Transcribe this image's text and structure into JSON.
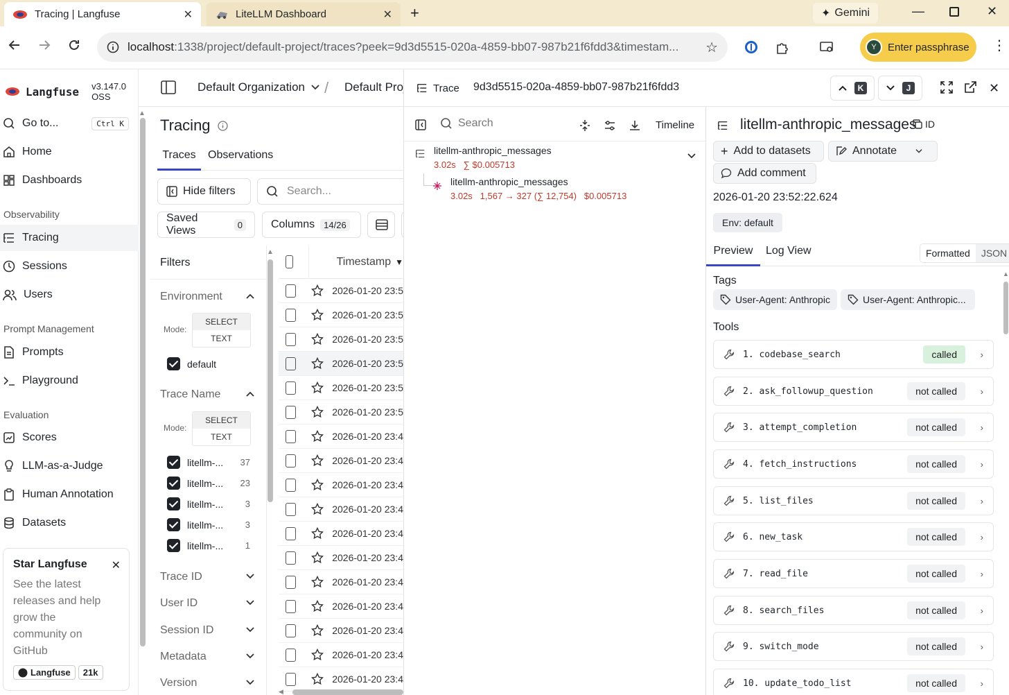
{
  "browser": {
    "tabs": [
      {
        "title": "Tracing | Langfuse",
        "active": true
      },
      {
        "title": "LiteLLM Dashboard",
        "active": false
      }
    ],
    "gemini_label": "Gemini",
    "url_host": "localhost",
    "url_path": ":1338/project/default-project/traces?peek=9d3d5515-020a-4859-bb07-987b21f6fdd3&timestam...",
    "passphrase_label": "Enter passphrase",
    "avatar_letter": "Y"
  },
  "sidebar": {
    "brand": "Langfuse",
    "version": "v3.147.0 OSS",
    "goto_label": "Go to...",
    "goto_shortcut": "Ctrl K",
    "home": "Home",
    "dashboards": "Dashboards",
    "section_observability": "Observability",
    "tracing": "Tracing",
    "sessions": "Sessions",
    "users": "Users",
    "section_prompt": "Prompt Management",
    "prompts": "Prompts",
    "playground": "Playground",
    "section_eval": "Evaluation",
    "scores": "Scores",
    "llm_judge": "LLM-as-a-Judge",
    "human_annotation": "Human Annotation",
    "datasets": "Datasets",
    "star_card": {
      "title": "Star Langfuse",
      "body": "See the latest releases and help grow the community on GitHub",
      "gh_label": "Langfuse",
      "gh_count": "21k"
    }
  },
  "header": {
    "org": "Default Organization",
    "project": "Default Proj"
  },
  "tracing": {
    "title": "Tracing",
    "tabs": [
      "Traces",
      "Observations"
    ],
    "hide_filters": "Hide filters",
    "search_placeholder": "Search...",
    "saved_views": "Saved Views",
    "saved_views_count": "0",
    "columns": "Columns",
    "columns_count": "14/26",
    "filters_title": "Filters",
    "environment": "Environment",
    "mode_label": "Mode:",
    "mode_select": "SELECT",
    "mode_text": "TEXT",
    "env_option": "default",
    "trace_name": "Trace Name",
    "trace_name_options": [
      {
        "label": "litellm-...",
        "count": "37"
      },
      {
        "label": "litellm-...",
        "count": "23"
      },
      {
        "label": "litellm-...",
        "count": "3"
      },
      {
        "label": "litellm-...",
        "count": "3"
      },
      {
        "label": "litellm-...",
        "count": "1"
      }
    ],
    "collapsed_filters": [
      "Trace ID",
      "User ID",
      "Session ID",
      "Metadata",
      "Version"
    ],
    "timestamp_header": "Timestamp",
    "rows": [
      "2026-01-20 23:5",
      "2026-01-20 23:5",
      "2026-01-20 23:5",
      "2026-01-20 23:5",
      "2026-01-20 23:5",
      "2026-01-20 23:5",
      "2026-01-20 23:4",
      "2026-01-20 23:4",
      "2026-01-20 23:4",
      "2026-01-20 23:4",
      "2026-01-20 23:4",
      "2026-01-20 23:4",
      "2026-01-20 23:4",
      "2026-01-20 23:4",
      "2026-01-20 23:4",
      "2026-01-20 23:4",
      "2026-01-20 23:4"
    ]
  },
  "trace": {
    "label": "Trace",
    "id": "9d3d5515-020a-4859-bb07-987b21f6fdd3",
    "kbd_up": "K",
    "kbd_down": "J",
    "search_placeholder": "Search",
    "timeline": "Timeline",
    "root": {
      "name": "litellm-anthropic_messages",
      "latency": "3.02s",
      "cost": "∑ $0.005713"
    },
    "child": {
      "name": "litellm-anthropic_messages",
      "latency": "3.02s",
      "tokens": "1,567 → 327 (∑ 12,754)",
      "cost": "$0.005713"
    }
  },
  "detail": {
    "title": "litellm-anthropic_messages",
    "id_label": "ID",
    "add_to_datasets": "Add to datasets",
    "annotate": "Annotate",
    "add_comment": "Add comment",
    "timestamp": "2026-01-20 23:52:22.624",
    "env_badge": "Env: default",
    "tab_preview": "Preview",
    "tab_log": "Log View",
    "fmt_formatted": "Formatted",
    "fmt_json": "JSON",
    "tags_title": "Tags",
    "tags": [
      "User-Agent: Anthropic",
      "User-Agent: Anthropic..."
    ],
    "tools_title": "Tools",
    "tools": [
      {
        "name": "1. codebase_search",
        "status": "called"
      },
      {
        "name": "2. ask_followup_question",
        "status": "not called"
      },
      {
        "name": "3. attempt_completion",
        "status": "not called"
      },
      {
        "name": "4. fetch_instructions",
        "status": "not called"
      },
      {
        "name": "5. list_files",
        "status": "not called"
      },
      {
        "name": "6. new_task",
        "status": "not called"
      },
      {
        "name": "7. read_file",
        "status": "not called"
      },
      {
        "name": "8. search_files",
        "status": "not called"
      },
      {
        "name": "9. switch_mode",
        "status": "not called"
      },
      {
        "name": "10. update_todo_list",
        "status": "not called"
      }
    ]
  },
  "colors": {
    "accent": "#3b46c6",
    "latency_red": "#c0392b",
    "called_bg": "#d8f1dc",
    "tabbar_bg": "#f4ead0",
    "passphrase_bg": "#f6cd4a"
  }
}
